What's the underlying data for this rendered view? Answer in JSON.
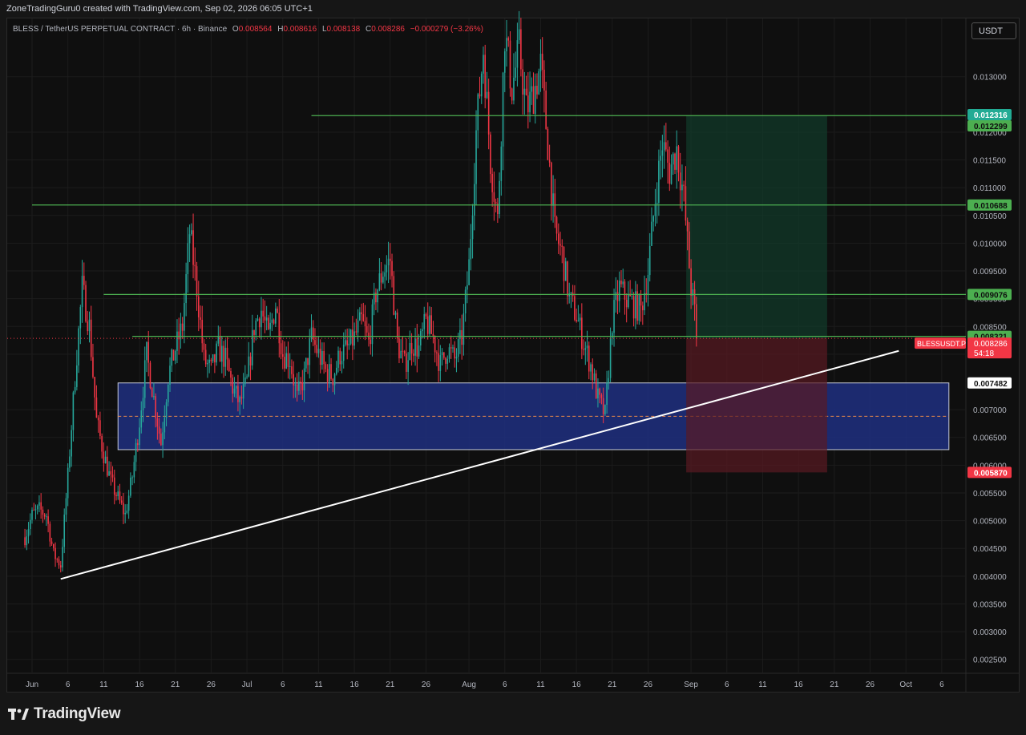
{
  "header": {
    "credit": "ZoneTradingGuru0 created with TradingView.com, Sep 02, 2026 06:05 UTC+1"
  },
  "legend": {
    "symbol": "BLESS / TetherUS PERPETUAL CONTRACT · 6h · Binance",
    "o_label": "O",
    "o_value": "0.008564",
    "h_label": "H",
    "h_value": "0.008616",
    "l_label": "L",
    "l_value": "0.008138",
    "c_label": "C",
    "c_value": "0.008286",
    "change": "−0.000279 (−3.26%)"
  },
  "currency_badge": "USDT",
  "logo": {
    "text": "TradingView"
  },
  "colors": {
    "up": "#26a69a",
    "down": "#f23645",
    "level_line": "#4caf50",
    "zone_fill": "#1e2f80",
    "target_fill": "#113a2a",
    "stop_fill": "#5a1a22",
    "trendline": "#ffffff"
  },
  "chart_data": {
    "type": "candlestick",
    "symbol_label": "BLESSUSDT.P",
    "timeframe": "6h",
    "last_price": 0.008286,
    "countdown": "54:18",
    "ylim": [
      0.00225,
      0.01405
    ],
    "y_ticks": [
      "0.013000",
      "0.012000",
      "0.011500",
      "0.011000",
      "0.010500",
      "0.010000",
      "0.009500",
      "0.009000",
      "0.008500",
      "0.008000",
      "0.007000",
      "0.006500",
      "0.006000",
      "0.005500",
      "0.005000",
      "0.004500",
      "0.004000",
      "0.003500",
      "0.003000",
      "0.002500"
    ],
    "x_ticks": [
      "Jun",
      "6",
      "11",
      "16",
      "21",
      "26",
      "Jul",
      "6",
      "11",
      "16",
      "21",
      "26",
      "Aug",
      "6",
      "11",
      "16",
      "21",
      "26",
      "Sep",
      "6",
      "11",
      "16",
      "21",
      "26",
      "Oct",
      "6"
    ],
    "price_labels": [
      {
        "text": "0.012316",
        "kind": "target"
      },
      {
        "text": "0.012299",
        "kind": "level"
      },
      {
        "text": "0.010688",
        "kind": "level"
      },
      {
        "text": "0.009076",
        "kind": "level"
      },
      {
        "text": "0.008321",
        "kind": "level"
      },
      {
        "text": "0.007482",
        "kind": "zone"
      },
      {
        "text": "0.005870",
        "kind": "stop"
      }
    ],
    "horizontal_levels": [
      {
        "price": 0.012299,
        "from": "Jul 10"
      },
      {
        "price": 0.010688,
        "from": "Jun 1"
      },
      {
        "price": 0.009076,
        "from": "Jun 11"
      },
      {
        "price": 0.008321,
        "from": "Jun 15"
      }
    ],
    "demand_zone": {
      "top": 0.007482,
      "bottom": 0.00628,
      "midline": 0.00688,
      "from": "Jun 13",
      "to": "Oct 7"
    },
    "position": {
      "entry": 0.008286,
      "target": 0.012299,
      "stop": 0.00587,
      "from": "Sep 1",
      "to": "Sep 20"
    },
    "trendline": {
      "start": {
        "date": "Jun 5",
        "price": 0.00395
      },
      "end": {
        "date": "Sep 30",
        "price": 0.00806
      }
    },
    "price_path": [
      {
        "date": "May 31",
        "price": 0.0047
      },
      {
        "date": "Jun 1",
        "price": 0.0051
      },
      {
        "date": "Jun 2",
        "price": 0.0052
      },
      {
        "date": "Jun 3",
        "price": 0.0051
      },
      {
        "date": "Jun 4",
        "price": 0.0044
      },
      {
        "date": "Jun 5",
        "price": 0.0042
      },
      {
        "date": "Jun 6",
        "price": 0.0058
      },
      {
        "date": "Jun 7",
        "price": 0.0076
      },
      {
        "date": "Jun 8",
        "price": 0.0092
      },
      {
        "date": "Jun 9",
        "price": 0.0085
      },
      {
        "date": "Jun 10",
        "price": 0.0068
      },
      {
        "date": "Jun 11",
        "price": 0.0062
      },
      {
        "date": "Jun 12",
        "price": 0.0057
      },
      {
        "date": "Jun 13",
        "price": 0.0054
      },
      {
        "date": "Jun 14",
        "price": 0.0051
      },
      {
        "date": "Jun 15",
        "price": 0.0058
      },
      {
        "date": "Jun 16",
        "price": 0.0068
      },
      {
        "date": "Jun 17",
        "price": 0.008
      },
      {
        "date": "Jun 18",
        "price": 0.0072
      },
      {
        "date": "Jun 19",
        "price": 0.0064
      },
      {
        "date": "Jun 20",
        "price": 0.0076
      },
      {
        "date": "Jun 21",
        "price": 0.0081
      },
      {
        "date": "Jun 22",
        "price": 0.0085
      },
      {
        "date": "Jun 23",
        "price": 0.0102
      },
      {
        "date": "Jun 24",
        "price": 0.0092
      },
      {
        "date": "Jun 25",
        "price": 0.0079
      },
      {
        "date": "Jun 26",
        "price": 0.0077
      },
      {
        "date": "Jun 27",
        "price": 0.0081
      },
      {
        "date": "Jun 28",
        "price": 0.0079
      },
      {
        "date": "Jun 29",
        "price": 0.0074
      },
      {
        "date": "Jun 30",
        "price": 0.0071
      },
      {
        "date": "Jul 1",
        "price": 0.0075
      },
      {
        "date": "Jul 2",
        "price": 0.0085
      },
      {
        "date": "Jul 3",
        "price": 0.0088
      },
      {
        "date": "Jul 4",
        "price": 0.0083
      },
      {
        "date": "Jul 5",
        "price": 0.0089
      },
      {
        "date": "Jul 6",
        "price": 0.008
      },
      {
        "date": "Jul 7",
        "price": 0.0079
      },
      {
        "date": "Jul 8",
        "price": 0.0072
      },
      {
        "date": "Jul 9",
        "price": 0.0076
      },
      {
        "date": "Jul 10",
        "price": 0.0083
      },
      {
        "date": "Jul 11",
        "price": 0.008
      },
      {
        "date": "Jul 12",
        "price": 0.0077
      },
      {
        "date": "Jul 13",
        "price": 0.0076
      },
      {
        "date": "Jul 14",
        "price": 0.008
      },
      {
        "date": "Jul 15",
        "price": 0.0081
      },
      {
        "date": "Jul 16",
        "price": 0.0083
      },
      {
        "date": "Jul 17",
        "price": 0.0086
      },
      {
        "date": "Jul 18",
        "price": 0.0082
      },
      {
        "date": "Jul 19",
        "price": 0.0091
      },
      {
        "date": "Jul 20",
        "price": 0.0095
      },
      {
        "date": "Jul 21",
        "price": 0.0097
      },
      {
        "date": "Jul 22",
        "price": 0.0082
      },
      {
        "date": "Jul 23",
        "price": 0.0078
      },
      {
        "date": "Jul 24",
        "price": 0.0082
      },
      {
        "date": "Jul 25",
        "price": 0.0081
      },
      {
        "date": "Jul 26",
        "price": 0.0086
      },
      {
        "date": "Jul 27",
        "price": 0.0083
      },
      {
        "date": "Jul 28",
        "price": 0.0078
      },
      {
        "date": "Jul 29",
        "price": 0.0081
      },
      {
        "date": "Jul 30",
        "price": 0.0079
      },
      {
        "date": "Jul 31",
        "price": 0.0083
      },
      {
        "date": "Aug 1",
        "price": 0.0096
      },
      {
        "date": "Aug 2",
        "price": 0.012
      },
      {
        "date": "Aug 3",
        "price": 0.0135
      },
      {
        "date": "Aug 4",
        "price": 0.0115
      },
      {
        "date": "Aug 5",
        "price": 0.0104
      },
      {
        "date": "Aug 6",
        "price": 0.0138
      },
      {
        "date": "Aug 7",
        "price": 0.0128
      },
      {
        "date": "Aug 8",
        "price": 0.0135
      },
      {
        "date": "Aug 9",
        "price": 0.0124
      },
      {
        "date": "Aug 10",
        "price": 0.0127
      },
      {
        "date": "Aug 11",
        "price": 0.0132
      },
      {
        "date": "Aug 12",
        "price": 0.0118
      },
      {
        "date": "Aug 13",
        "price": 0.0102
      },
      {
        "date": "Aug 14",
        "price": 0.0098
      },
      {
        "date": "Aug 15",
        "price": 0.009
      },
      {
        "date": "Aug 16",
        "price": 0.0087
      },
      {
        "date": "Aug 17",
        "price": 0.0082
      },
      {
        "date": "Aug 18",
        "price": 0.0078
      },
      {
        "date": "Aug 19",
        "price": 0.0072
      },
      {
        "date": "Aug 20",
        "price": 0.0069
      },
      {
        "date": "Aug 21",
        "price": 0.0086
      },
      {
        "date": "Aug 22",
        "price": 0.0092
      },
      {
        "date": "Aug 23",
        "price": 0.009
      },
      {
        "date": "Aug 24",
        "price": 0.0089
      },
      {
        "date": "Aug 25",
        "price": 0.0088
      },
      {
        "date": "Aug 26",
        "price": 0.0095
      },
      {
        "date": "Aug 27",
        "price": 0.0108
      },
      {
        "date": "Aug 28",
        "price": 0.0118
      },
      {
        "date": "Aug 29",
        "price": 0.0113
      },
      {
        "date": "Aug 30",
        "price": 0.0117
      },
      {
        "date": "Aug 31",
        "price": 0.0108
      },
      {
        "date": "Sep 1",
        "price": 0.0092
      },
      {
        "date": "Sep 2",
        "price": 0.008286
      }
    ],
    "grid": true
  }
}
